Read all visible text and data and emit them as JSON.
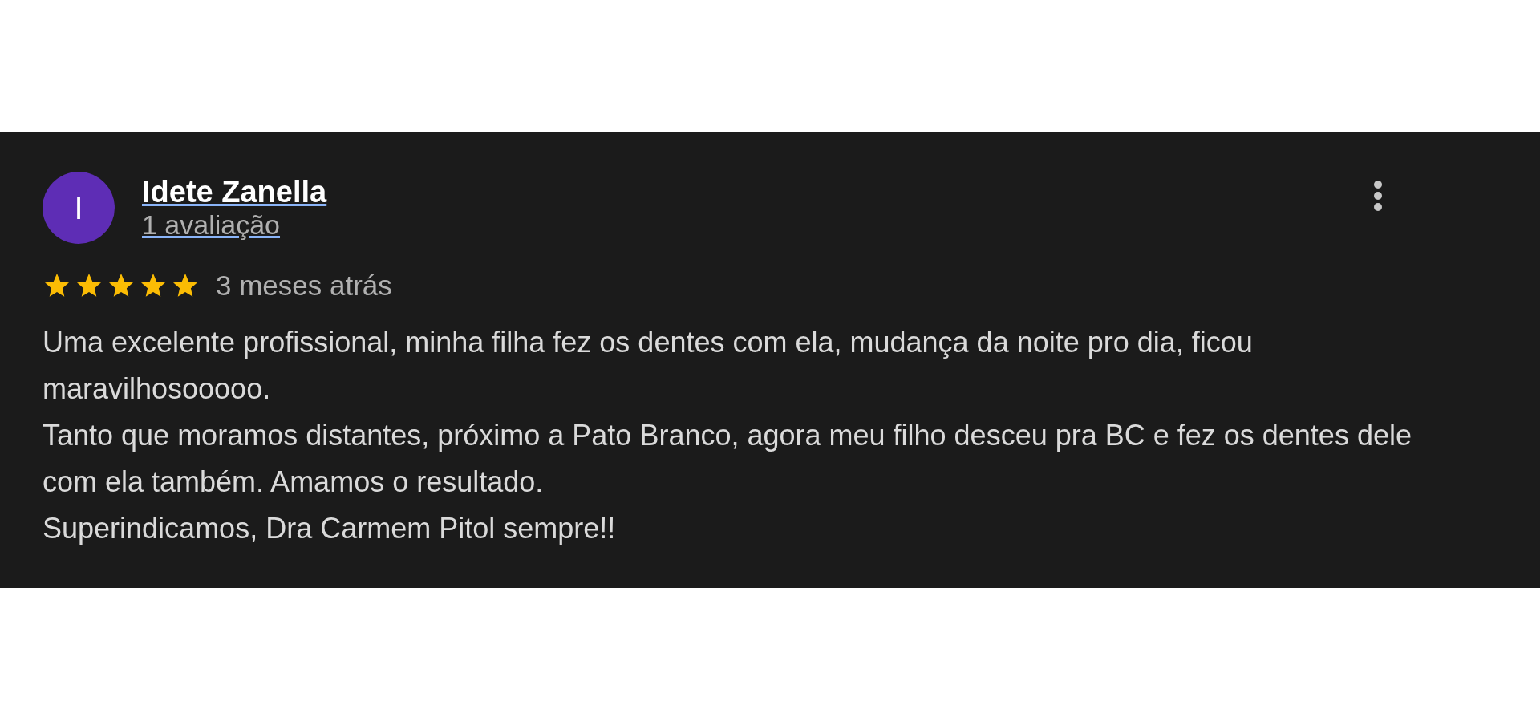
{
  "review": {
    "avatar_letter": "I",
    "color": "#5e2db5",
    "author": "Idete Zanella",
    "author_reviews": "1 avaliação",
    "stars": 5,
    "time": "3 meses atrás",
    "paragraphs": [
      "Uma excelente profissional, minha filha fez os dentes com ela, mudança da noite pro dia, ficou maravilhosooooo.",
      "Tanto que moramos distantes, próximo a Pato Branco, agora meu filho desceu pra BC e fez os dentes dele com ela também. Amamos o resultado.",
      "Superindicamos, Dra Carmem Pitol sempre!!"
    ]
  }
}
